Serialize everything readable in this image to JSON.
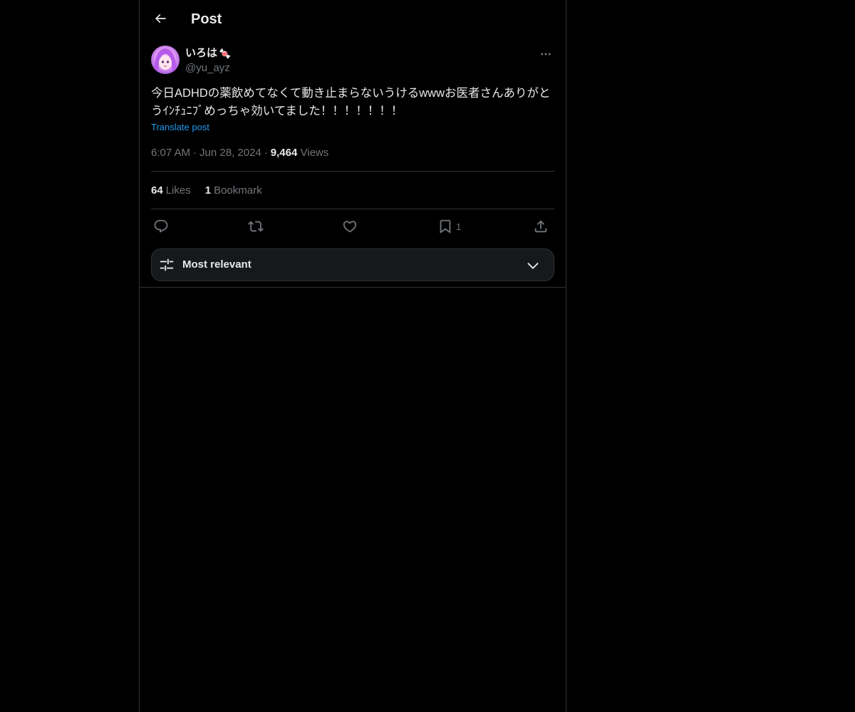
{
  "header": {
    "title": "Post",
    "back_icon": "arrow-left-icon"
  },
  "author": {
    "display_name": "いろは",
    "badge_emoji": "🍬",
    "handle": "@yu_ayz",
    "avatar_colors": [
      "#c77dff",
      "#f8c8ff"
    ]
  },
  "post": {
    "text": "今日ADHDの薬飲めてなくて動き止まらないうけるwwwお医者さんありがとうｲﾝﾁｭﾆﾌﾞめっちゃ効いてました！！！！！！！",
    "translate_label": "Translate post",
    "time": "6:07 AM",
    "date": "Jun 28, 2024",
    "views_count": "9,464",
    "views_label": "Views"
  },
  "stats": {
    "likes_count": "64",
    "likes_label": "Likes",
    "bookmarks_count": "1",
    "bookmarks_label": "Bookmark"
  },
  "actions": {
    "reply_icon": "reply-icon",
    "repost_icon": "repost-icon",
    "like_icon": "heart-icon",
    "bookmark_icon": "bookmark-icon",
    "bookmark_count": "1",
    "share_icon": "share-icon"
  },
  "sort": {
    "label": "Most relevant",
    "icon": "sliders-icon",
    "chevron": "chevron-down-icon"
  },
  "colors": {
    "background": "#000000",
    "text": "#e7e9ea",
    "muted": "#71767b",
    "link": "#1d9bf0",
    "border": "#2f3336"
  }
}
